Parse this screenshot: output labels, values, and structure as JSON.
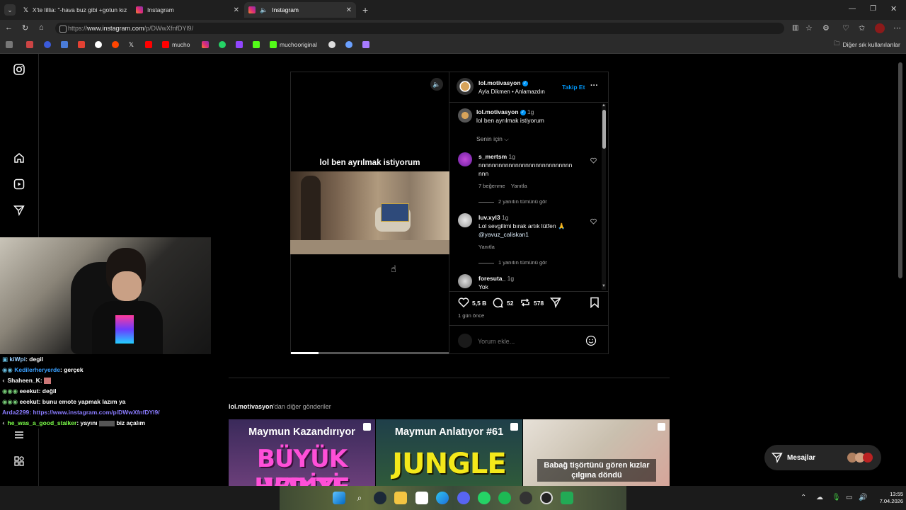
{
  "tabs": [
    {
      "label": "X'te lillia: \"-hava buz gibi +gotun kız",
      "icon": "x-logo-icon"
    },
    {
      "label": "Instagram",
      "icon": "instagram-icon"
    },
    {
      "label": "Instagram",
      "icon": "instagram-icon",
      "active": true
    }
  ],
  "address": {
    "prefix": "https://",
    "host": "www.instagram.com",
    "path": "/p/DWwXfnfDYl9/"
  },
  "bookmarks": {
    "mucho": "mucho",
    "muchooriginal": "muchooriginal",
    "other": "Diğer sık kullanılanlar"
  },
  "post": {
    "caption_overlay": "lol ben ayrılmak istiyorum",
    "author": "lol.motivasyon",
    "audio": "Ayla Dikmen • Anlamazdın",
    "follow": "Takip Et",
    "more": "···",
    "caption_author": "lol.motivasyon",
    "caption_time": "1g",
    "caption_text": "lol ben ayrılmak istiyorum",
    "sort_label": "Senin için"
  },
  "comments": [
    {
      "user": "s_mertsm",
      "time": "1g",
      "text1": "nnnnnnnnnnnnnnnnnnnnnnnnnnnn",
      "text2": "nnn",
      "likes": "7 beğenme",
      "reply": "Yanıtla",
      "view_replies": "2 yanıtın tümünü gör"
    },
    {
      "user": "luv.xyl3",
      "time": "1g",
      "text1": "Lol sevgilimi bırak artık lütfen 🙏",
      "mention": "@yavuz_caliskan1",
      "reply": "Yanıtla",
      "view_replies": "1 yanıtın tümünü gör"
    },
    {
      "user": "foresuta_",
      "time": "1g",
      "text1": "Yok"
    }
  ],
  "actions": {
    "likes": "5,5 B",
    "comments": "52",
    "reposts": "578",
    "posted": "1 gün önce",
    "comment_placeholder": "Yorum ekle..."
  },
  "more_posts": {
    "author": "lol.motivasyon",
    "suffix": "'dan diğer gönderiler",
    "items": [
      {
        "title": "Maymun Kazandırıyor",
        "big": "BÜYÜK HEDİYE",
        "big2": "VAKTİ"
      },
      {
        "title": "Maymun Anlatıyor #61",
        "big": "JUNGLE"
      },
      {
        "caption": "Babağ tişörtünü gören kızlar çılgına döndü"
      }
    ]
  },
  "messages_label": "Mesajlar",
  "chat": [
    {
      "user": "kiWpi",
      "msg": ": degil",
      "color": "#9ad0ff"
    },
    {
      "user": "Kedilerheryerde",
      "msg": ": gerçek",
      "color": "#3aa0ff"
    },
    {
      "user": "Shaheen_K",
      "msg": ":",
      "color": "#ffffff"
    },
    {
      "user": "eeekut",
      "msg": ": değil",
      "color": "#ffffff"
    },
    {
      "user": "eeekut",
      "msg": ": bunu emote yapmak lazım ya",
      "color": "#ffffff"
    },
    {
      "user": "Arda2299",
      "msg": ": https://www.instagram.com/p/DWwXfnfDYl9/",
      "color": "#8a7bff"
    },
    {
      "user": "he_was_a_good_stalker",
      "msg": ": yayını",
      "msg2": "biz açalım",
      "color": "#7cff4a"
    }
  ],
  "clock": {
    "time": "13:55",
    "date": "7.04.2026"
  },
  "colors": {
    "accent": "#0095f6",
    "bg": "#000000"
  }
}
